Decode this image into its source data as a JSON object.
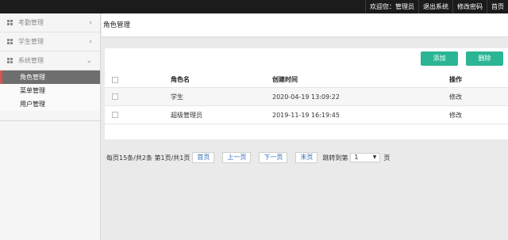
{
  "topbar": {
    "welcome": "欢迎您：管理员",
    "logout": "退出系统",
    "change_password": "修改密码",
    "home": "首页"
  },
  "sidebar": {
    "groups": [
      {
        "label": "考勤管理",
        "chevron": "‹"
      },
      {
        "label": "学生管理",
        "chevron": "‹"
      },
      {
        "label": "系统管理",
        "chevron": "⌄"
      }
    ],
    "sub_items": [
      {
        "label": "角色管理",
        "active": true
      },
      {
        "label": "菜单管理",
        "active": false
      },
      {
        "label": "用户管理",
        "active": false
      }
    ]
  },
  "page": {
    "title": "角色管理"
  },
  "toolbar": {
    "add_label": "添加",
    "delete_label": "删除"
  },
  "table": {
    "headers": {
      "name": "角色名",
      "created": "创建时间",
      "operation": "操作"
    },
    "rows": [
      {
        "name": "学生",
        "created": "2020-04-19 13:09:22",
        "operation": "修改"
      },
      {
        "name": "超级管理员",
        "created": "2019-11-19 16:19:45",
        "operation": "修改"
      }
    ]
  },
  "pager": {
    "info": "每页15条/共2条 第1页/共1页",
    "first": "首页",
    "prev": "上一页",
    "next": "下一页",
    "last": "末页",
    "jump_label": "跳转到第",
    "page_value": "1",
    "page_suffix": "页"
  },
  "colors": {
    "accent_green": "#2bb594",
    "topbar_bg": "#1b1b1b",
    "active_item_bg": "#6e6e6e",
    "active_marker": "#d9534f"
  }
}
